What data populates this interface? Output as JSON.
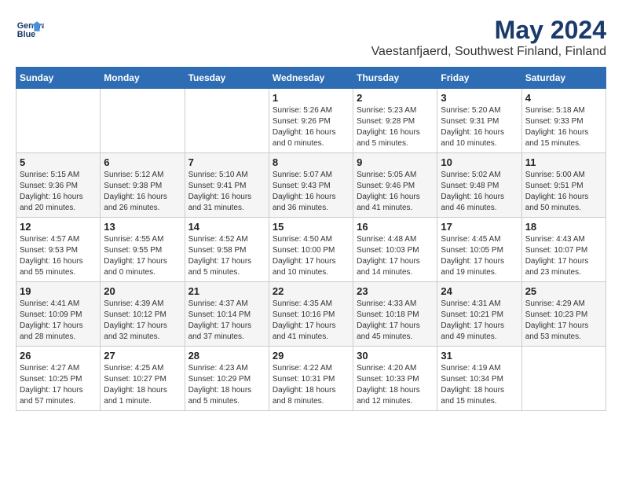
{
  "logo": {
    "line1": "General",
    "line2": "Blue"
  },
  "title": "May 2024",
  "subtitle": "Vaestanfjaerd, Southwest Finland, Finland",
  "days_of_week": [
    "Sunday",
    "Monday",
    "Tuesday",
    "Wednesday",
    "Thursday",
    "Friday",
    "Saturday"
  ],
  "weeks": [
    [
      {
        "day": "",
        "details": ""
      },
      {
        "day": "",
        "details": ""
      },
      {
        "day": "",
        "details": ""
      },
      {
        "day": "1",
        "details": "Sunrise: 5:26 AM\nSunset: 9:26 PM\nDaylight: 16 hours\nand 0 minutes."
      },
      {
        "day": "2",
        "details": "Sunrise: 5:23 AM\nSunset: 9:28 PM\nDaylight: 16 hours\nand 5 minutes."
      },
      {
        "day": "3",
        "details": "Sunrise: 5:20 AM\nSunset: 9:31 PM\nDaylight: 16 hours\nand 10 minutes."
      },
      {
        "day": "4",
        "details": "Sunrise: 5:18 AM\nSunset: 9:33 PM\nDaylight: 16 hours\nand 15 minutes."
      }
    ],
    [
      {
        "day": "5",
        "details": "Sunrise: 5:15 AM\nSunset: 9:36 PM\nDaylight: 16 hours\nand 20 minutes."
      },
      {
        "day": "6",
        "details": "Sunrise: 5:12 AM\nSunset: 9:38 PM\nDaylight: 16 hours\nand 26 minutes."
      },
      {
        "day": "7",
        "details": "Sunrise: 5:10 AM\nSunset: 9:41 PM\nDaylight: 16 hours\nand 31 minutes."
      },
      {
        "day": "8",
        "details": "Sunrise: 5:07 AM\nSunset: 9:43 PM\nDaylight: 16 hours\nand 36 minutes."
      },
      {
        "day": "9",
        "details": "Sunrise: 5:05 AM\nSunset: 9:46 PM\nDaylight: 16 hours\nand 41 minutes."
      },
      {
        "day": "10",
        "details": "Sunrise: 5:02 AM\nSunset: 9:48 PM\nDaylight: 16 hours\nand 46 minutes."
      },
      {
        "day": "11",
        "details": "Sunrise: 5:00 AM\nSunset: 9:51 PM\nDaylight: 16 hours\nand 50 minutes."
      }
    ],
    [
      {
        "day": "12",
        "details": "Sunrise: 4:57 AM\nSunset: 9:53 PM\nDaylight: 16 hours\nand 55 minutes."
      },
      {
        "day": "13",
        "details": "Sunrise: 4:55 AM\nSunset: 9:55 PM\nDaylight: 17 hours\nand 0 minutes."
      },
      {
        "day": "14",
        "details": "Sunrise: 4:52 AM\nSunset: 9:58 PM\nDaylight: 17 hours\nand 5 minutes."
      },
      {
        "day": "15",
        "details": "Sunrise: 4:50 AM\nSunset: 10:00 PM\nDaylight: 17 hours\nand 10 minutes."
      },
      {
        "day": "16",
        "details": "Sunrise: 4:48 AM\nSunset: 10:03 PM\nDaylight: 17 hours\nand 14 minutes."
      },
      {
        "day": "17",
        "details": "Sunrise: 4:45 AM\nSunset: 10:05 PM\nDaylight: 17 hours\nand 19 minutes."
      },
      {
        "day": "18",
        "details": "Sunrise: 4:43 AM\nSunset: 10:07 PM\nDaylight: 17 hours\nand 23 minutes."
      }
    ],
    [
      {
        "day": "19",
        "details": "Sunrise: 4:41 AM\nSunset: 10:09 PM\nDaylight: 17 hours\nand 28 minutes."
      },
      {
        "day": "20",
        "details": "Sunrise: 4:39 AM\nSunset: 10:12 PM\nDaylight: 17 hours\nand 32 minutes."
      },
      {
        "day": "21",
        "details": "Sunrise: 4:37 AM\nSunset: 10:14 PM\nDaylight: 17 hours\nand 37 minutes."
      },
      {
        "day": "22",
        "details": "Sunrise: 4:35 AM\nSunset: 10:16 PM\nDaylight: 17 hours\nand 41 minutes."
      },
      {
        "day": "23",
        "details": "Sunrise: 4:33 AM\nSunset: 10:18 PM\nDaylight: 17 hours\nand 45 minutes."
      },
      {
        "day": "24",
        "details": "Sunrise: 4:31 AM\nSunset: 10:21 PM\nDaylight: 17 hours\nand 49 minutes."
      },
      {
        "day": "25",
        "details": "Sunrise: 4:29 AM\nSunset: 10:23 PM\nDaylight: 17 hours\nand 53 minutes."
      }
    ],
    [
      {
        "day": "26",
        "details": "Sunrise: 4:27 AM\nSunset: 10:25 PM\nDaylight: 17 hours\nand 57 minutes."
      },
      {
        "day": "27",
        "details": "Sunrise: 4:25 AM\nSunset: 10:27 PM\nDaylight: 18 hours\nand 1 minute."
      },
      {
        "day": "28",
        "details": "Sunrise: 4:23 AM\nSunset: 10:29 PM\nDaylight: 18 hours\nand 5 minutes."
      },
      {
        "day": "29",
        "details": "Sunrise: 4:22 AM\nSunset: 10:31 PM\nDaylight: 18 hours\nand 8 minutes."
      },
      {
        "day": "30",
        "details": "Sunrise: 4:20 AM\nSunset: 10:33 PM\nDaylight: 18 hours\nand 12 minutes."
      },
      {
        "day": "31",
        "details": "Sunrise: 4:19 AM\nSunset: 10:34 PM\nDaylight: 18 hours\nand 15 minutes."
      },
      {
        "day": "",
        "details": ""
      }
    ]
  ]
}
